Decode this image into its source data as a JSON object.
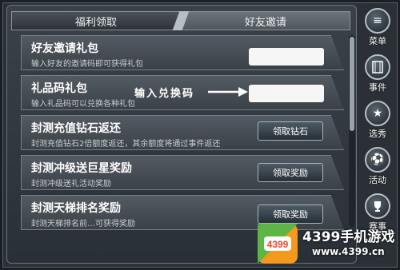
{
  "tabs": [
    {
      "label": "福利领取",
      "active": false
    },
    {
      "label": "好友邀请",
      "active": true
    }
  ],
  "rows": [
    {
      "title": "好友邀请礼包",
      "subtitle": "输入好友的邀请码即可获得礼包",
      "control": "input",
      "value": ""
    },
    {
      "title": "礼品码礼包",
      "subtitle": "输入礼品码可以兑换各种礼包",
      "control": "input",
      "value": ""
    },
    {
      "title": "封测充值钻石返还",
      "subtitle": "封测充值钻石2倍额度返还，其余额度将通过事件返还",
      "control": "button",
      "button_label": "领取钻石"
    },
    {
      "title": "封测冲级送巨星奖励",
      "subtitle": "封测冲级送礼活动奖励",
      "control": "button",
      "button_label": "领取奖励"
    },
    {
      "title": "封测天梯排名奖励",
      "subtitle": "封测天梯排名前…可获得奖励",
      "control": "button",
      "button_label": "领取奖励"
    }
  ],
  "callout": {
    "text": "输入兑换码"
  },
  "side_menu": [
    {
      "label": "菜单",
      "icon": "menu-icon"
    },
    {
      "label": "事件",
      "icon": "film-icon"
    },
    {
      "label": "选秀",
      "icon": "star-icon"
    },
    {
      "label": "活动",
      "icon": "soccer-ball-icon"
    },
    {
      "label": "赛事",
      "icon": "trophy-icon"
    },
    {
      "label": "",
      "icon": "home-icon"
    }
  ],
  "watermark": {
    "logo_text": "4399",
    "brand": "4399手机游戏",
    "url": "www.4399.cn"
  },
  "colors": {
    "panel_bg": "#2a3036",
    "row_bg": "#4a5259",
    "accent_white": "#ffffff",
    "logo_orange": "#f39a1e",
    "logo_green": "#4bb848"
  }
}
